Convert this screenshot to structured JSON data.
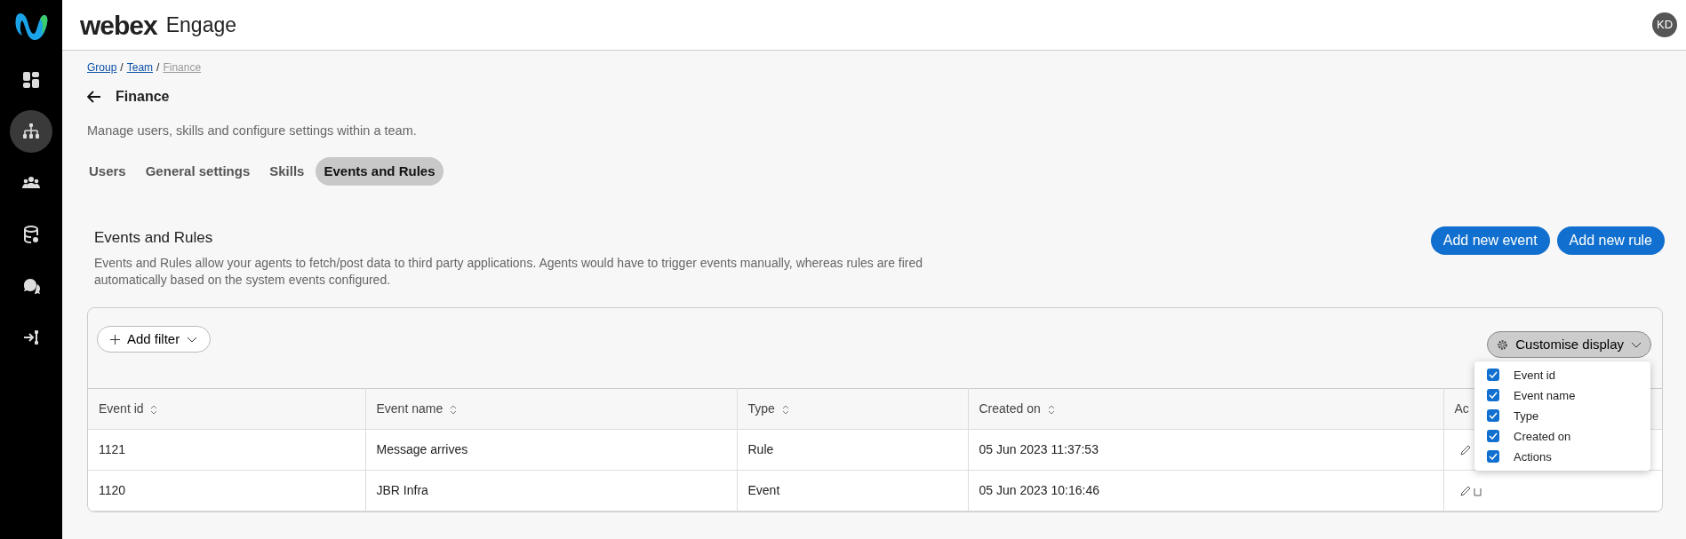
{
  "app": {
    "brand": "webex",
    "product": "Engage",
    "avatar": "KD"
  },
  "sidebar": {
    "items": [
      {
        "kind": "dashboard",
        "selected": false
      },
      {
        "kind": "hierarchy",
        "selected": true
      },
      {
        "kind": "people",
        "selected": false
      },
      {
        "kind": "database",
        "selected": false
      },
      {
        "kind": "chat",
        "selected": false
      },
      {
        "kind": "route",
        "selected": false
      }
    ]
  },
  "breadcrumb": [
    {
      "kind": "link",
      "label": "Group",
      "current": false
    },
    {
      "kind": "separator",
      "label": "/"
    },
    {
      "kind": "link",
      "label": "Team",
      "current": false
    },
    {
      "kind": "separator",
      "label": "/"
    },
    {
      "kind": "link",
      "label": "Finance",
      "current": true
    }
  ],
  "page": {
    "title": "Finance",
    "description": "Manage users, skills and configure settings within a team."
  },
  "tabs": [
    {
      "label": "Users",
      "selected": false
    },
    {
      "label": "General settings",
      "selected": false
    },
    {
      "label": "Skills",
      "selected": false
    },
    {
      "label": "Events and Rules",
      "selected": true
    }
  ],
  "section": {
    "title": "Events and Rules",
    "description": "Events and Rules allow your agents to fetch/post data to third party applications. Agents would have to trigger events manually, whereas rules are fired automatically based on the system events configured.",
    "buttons": [
      "Add new event",
      "Add new rule"
    ]
  },
  "toolbar": {
    "filter": "Add filter",
    "customise": "Customise display"
  },
  "table": {
    "columns": [
      {
        "label": "Event id",
        "sortable": true
      },
      {
        "label": "Event name",
        "sortable": true
      },
      {
        "label": "Type",
        "sortable": true
      },
      {
        "label": "Created on",
        "sortable": true
      },
      {
        "label": "Ac",
        "sortable": false
      }
    ],
    "rows": [
      {
        "cells": [
          "1121",
          "Message arrives",
          "Rule",
          "05 Jun 2023 11:37:53"
        ],
        "actions": [
          {
            "kind": "edit"
          }
        ]
      },
      {
        "cells": [
          "1120",
          "JBR Infra",
          "Event",
          "05 Jun 2023 10:16:46"
        ],
        "actions": [
          {
            "kind": "edit"
          },
          {
            "kind": "delete"
          }
        ]
      }
    ]
  },
  "display_menu": [
    {
      "label": "Event id",
      "checked": true
    },
    {
      "label": "Event name",
      "checked": true
    },
    {
      "label": "Type",
      "checked": true
    },
    {
      "label": "Created on",
      "checked": true
    },
    {
      "label": "Actions",
      "checked": true
    }
  ]
}
